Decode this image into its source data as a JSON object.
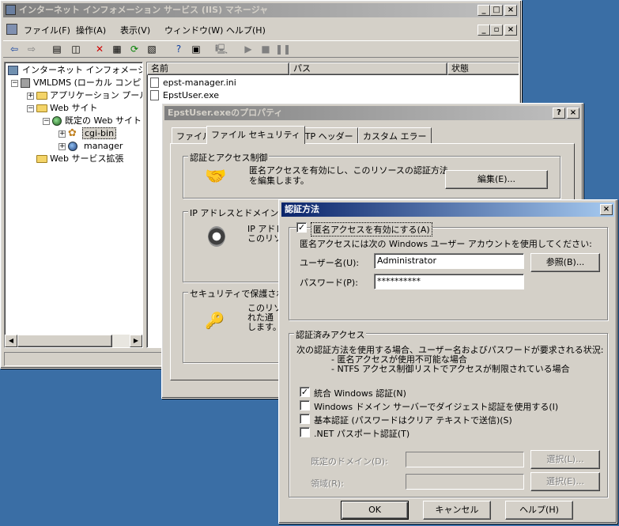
{
  "main_window": {
    "title": "インターネット インフォメーション サービス (IIS) マネージャ",
    "menu": [
      "ファイル(F)",
      "操作(A)",
      "表示(V)",
      "ウィンドウ(W)",
      "ヘルプ(H)"
    ],
    "tree": {
      "root": "インターネット インフォメーション",
      "server": "VMLDMS (ローカル コンピ",
      "app_pool": "アプリケーション プール",
      "web_sites": "Web サイト",
      "default_site": "既定の Web サイト",
      "cgi_bin": "cgi-bin",
      "manager": "manager",
      "web_ext": "Web サービス拡張"
    },
    "list": {
      "columns": [
        "名前",
        "パス",
        "状態"
      ],
      "rows": [
        "epst-manager.ini",
        "EpstUser.exe"
      ]
    }
  },
  "props_dialog": {
    "title": "EpstUser.exeのプロパティ",
    "tabs": [
      "ファイル",
      "ファイル セキュリティ",
      "HTTP ヘッダー",
      "カスタム エラー"
    ],
    "auth_group": "認証とアクセス制御",
    "auth_desc_1": "匿名アクセスを有効にし、このリソースの認証方法",
    "auth_desc_2": "を編集します。",
    "edit_button": "編集(E)...",
    "ip_group": "IP アドレスとドメイン名の",
    "ip_desc_1": "IP アドレ",
    "ip_desc_2": "このリソー",
    "secure_group": "セキュリティで保護された",
    "secure_desc_1": "このリソー",
    "secure_desc_2": "れた通",
    "secure_desc_3": "します。"
  },
  "auth_dialog": {
    "title": "認証方法",
    "anon_checkbox": "匿名アクセスを有効にする(A)",
    "anon_desc": "匿名アクセスには次の Windows ユーザー アカウントを使用してください:",
    "username_label": "ユーザー名(U):",
    "username_value": "Administrator",
    "browse_button": "参照(B)...",
    "password_label": "パスワード(P):",
    "password_value": "**********",
    "authed_group": "認証済みアクセス",
    "authed_desc": "次の認証方法を使用する場合、ユーザー名およびパスワードが要求される状況:",
    "authed_item_1": "- 匿名アクセスが使用不可能な場合",
    "authed_item_2": "- NTFS アクセス制御リストでアクセスが制限されている場合",
    "integrated": "統合 Windows 認証(N)",
    "digest": "Windows ドメイン サーバーでダイジェスト認証を使用する(I)",
    "basic": "基本認証 (パスワードはクリア テキストで送信)(S)",
    "passport": ".NET パスポート認証(T)",
    "default_domain_label": "既定のドメイン(D):",
    "realm_label": "領域(R):",
    "select_button_1": "選択(L)...",
    "select_button_2": "選択(E)...",
    "ok_button": "OK",
    "cancel_button": "キャンセル",
    "help_button": "ヘルプ(H)"
  },
  "colors": {
    "desktop": "#3a6ea5",
    "active_title": "#0a246a",
    "face": "#d4d0c8"
  }
}
